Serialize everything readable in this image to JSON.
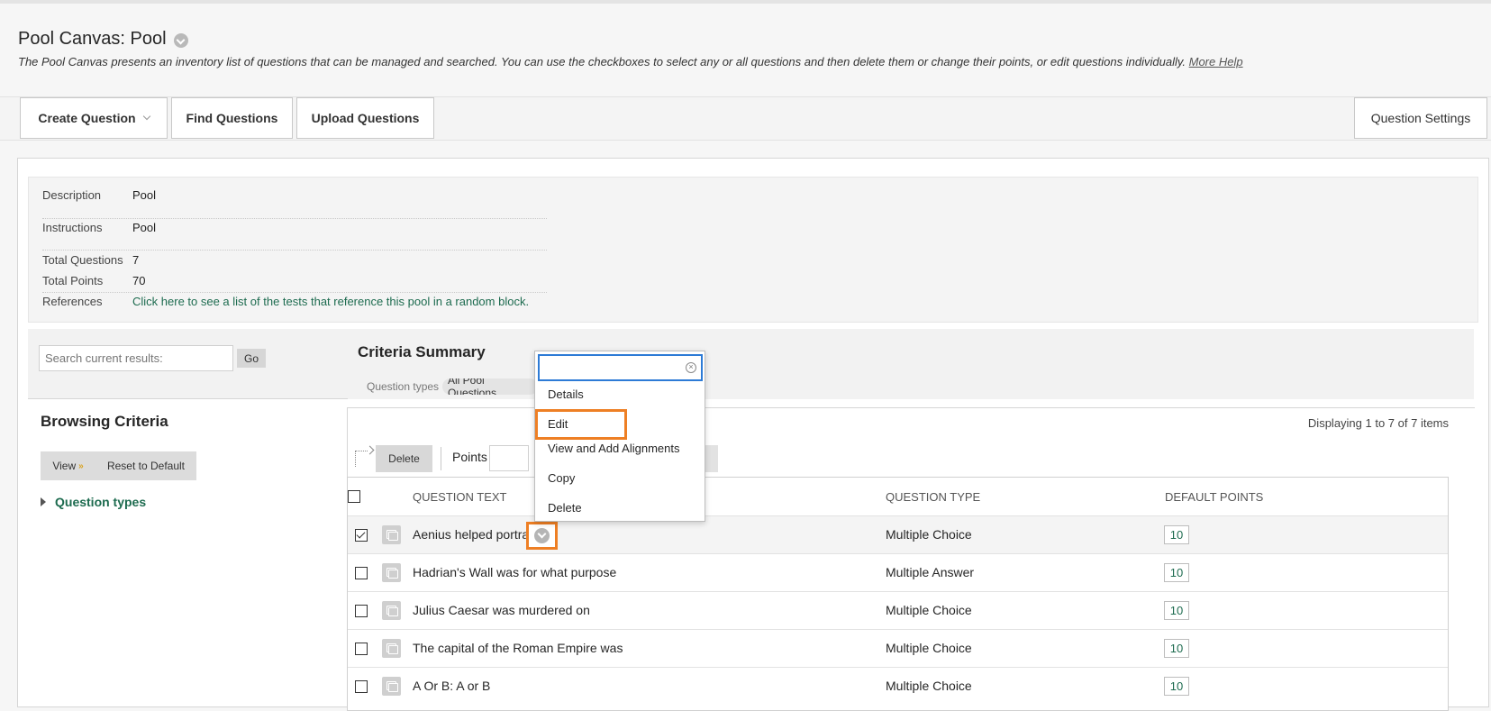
{
  "page": {
    "title": "Pool Canvas: Pool",
    "description": "The Pool Canvas presents an inventory list of questions that can be managed and searched. You can use the checkboxes to select any or all questions and then delete them or change their points, or edit questions individually.",
    "more_help": "More Help"
  },
  "toolbar": {
    "create_question": "Create Question",
    "find_questions": "Find Questions",
    "upload_questions": "Upload Questions",
    "question_settings": "Question Settings"
  },
  "info": {
    "description_label": "Description",
    "description_value": "Pool",
    "instructions_label": "Instructions",
    "instructions_value": "Pool",
    "total_questions_label": "Total Questions",
    "total_questions_value": "7",
    "total_points_label": "Total Points",
    "total_points_value": "70",
    "references_label": "References",
    "references_link": "Click here to see a list of the tests that reference this pool in a random block."
  },
  "search": {
    "placeholder": "Search current results:",
    "go": "Go"
  },
  "browsing": {
    "title": "Browsing Criteria",
    "view": "View",
    "view_icon": "double-chevron-down-icon",
    "reset": "Reset to Default",
    "question_types": "Question types"
  },
  "criteria": {
    "title": "Criteria Summary",
    "question_types_label": "Question types",
    "question_types_value": "All Pool Questions"
  },
  "table_controls": {
    "displaying": "Displaying 1 to 7 of 7 items",
    "delete": "Delete",
    "points": "Points"
  },
  "table": {
    "headers": {
      "question_text": "QUESTION TEXT",
      "question_type": "QUESTION TYPE",
      "default_points": "DEFAULT POINTS"
    },
    "rows": [
      {
        "text": "Aenius helped portray",
        "type": "Multiple Choice",
        "points": "10",
        "checked": true
      },
      {
        "text": "Hadrian's Wall was for what purpose",
        "type": "Multiple Answer",
        "points": "10",
        "checked": false
      },
      {
        "text": "Julius Caesar was murdered on",
        "type": "Multiple Choice",
        "points": "10",
        "checked": false
      },
      {
        "text": "The capital of the Roman Empire was",
        "type": "Multiple Choice",
        "points": "10",
        "checked": false
      },
      {
        "text": "A Or B: A or B",
        "type": "Multiple Choice",
        "points": "10",
        "checked": false
      }
    ]
  },
  "context_menu": {
    "items": [
      "Details",
      "Edit",
      "View and Add Alignments",
      "Copy",
      "Delete"
    ]
  },
  "colors": {
    "highlight": "#ee7f24",
    "link": "#1d6b4f",
    "focus": "#2d7bd6"
  }
}
